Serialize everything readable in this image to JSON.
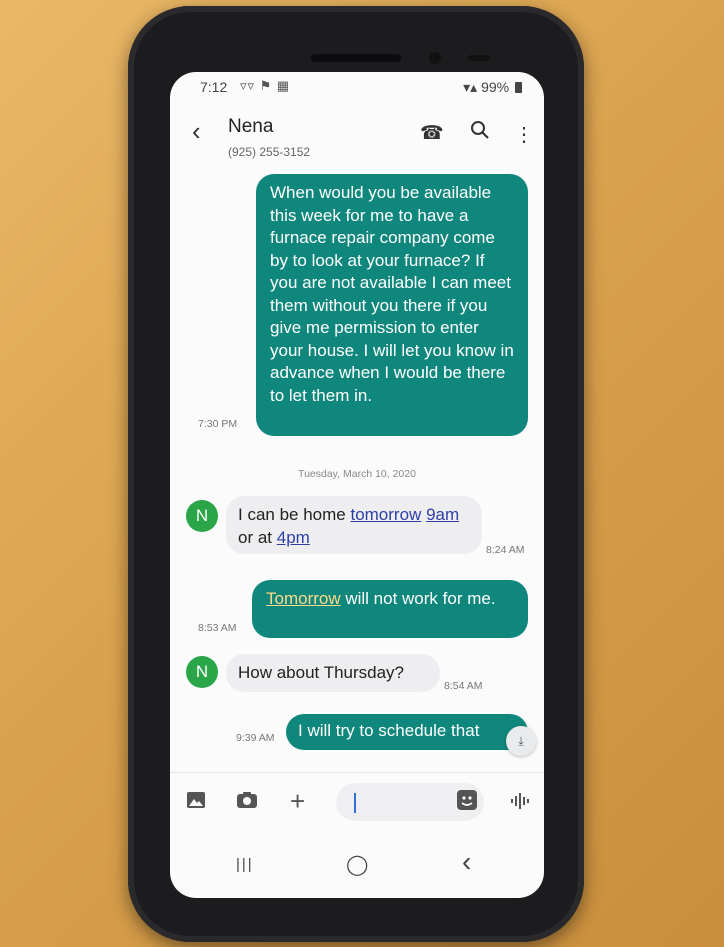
{
  "status_bar": {
    "time": "7:12",
    "icons": "▿▿ ⚑ ▦",
    "battery": "99%"
  },
  "header": {
    "contact_name": "Nena",
    "contact_number": "(925) 255-3152",
    "back_icon": "‹",
    "call_icon": "☎",
    "search_icon": "⚲",
    "more_icon": "⋮"
  },
  "messages": [
    {
      "direction": "outgoing",
      "text": "When would you be available this week for me to have a furnace repair company come by to look at your furnace?  If you are not available I can meet them without you there if you give me permission to enter your house.  I will let you know in advance when I would be there to let them in.",
      "time": "7:30 PM"
    },
    {
      "direction": "incoming",
      "avatar": "N",
      "parts": [
        "I can be home ",
        "tomorrow",
        " ",
        "9am",
        " or at ",
        "4pm"
      ],
      "time": "8:24 AM"
    },
    {
      "direction": "outgoing",
      "parts": [
        "Tomorrow",
        " will not work for me."
      ],
      "time": "8:53 AM"
    },
    {
      "direction": "incoming",
      "avatar": "N",
      "text": "How about  Thursday?",
      "time": "8:54 AM"
    },
    {
      "direction": "outgoing",
      "text": "I will try to schedule that",
      "time": "9:39 AM"
    }
  ],
  "date_separator": "Tuesday, March 10, 2020",
  "scroll_down_icon": "⤓",
  "composer": {
    "gallery_icon": "image-icon",
    "camera_icon": "camera-icon",
    "add_icon": "+",
    "sticker_icon": "sticker-icon",
    "voice_icon": "voice-icon"
  },
  "nav": {
    "recents_icon": "|||",
    "home_icon": "◯",
    "back_icon": "‹"
  }
}
